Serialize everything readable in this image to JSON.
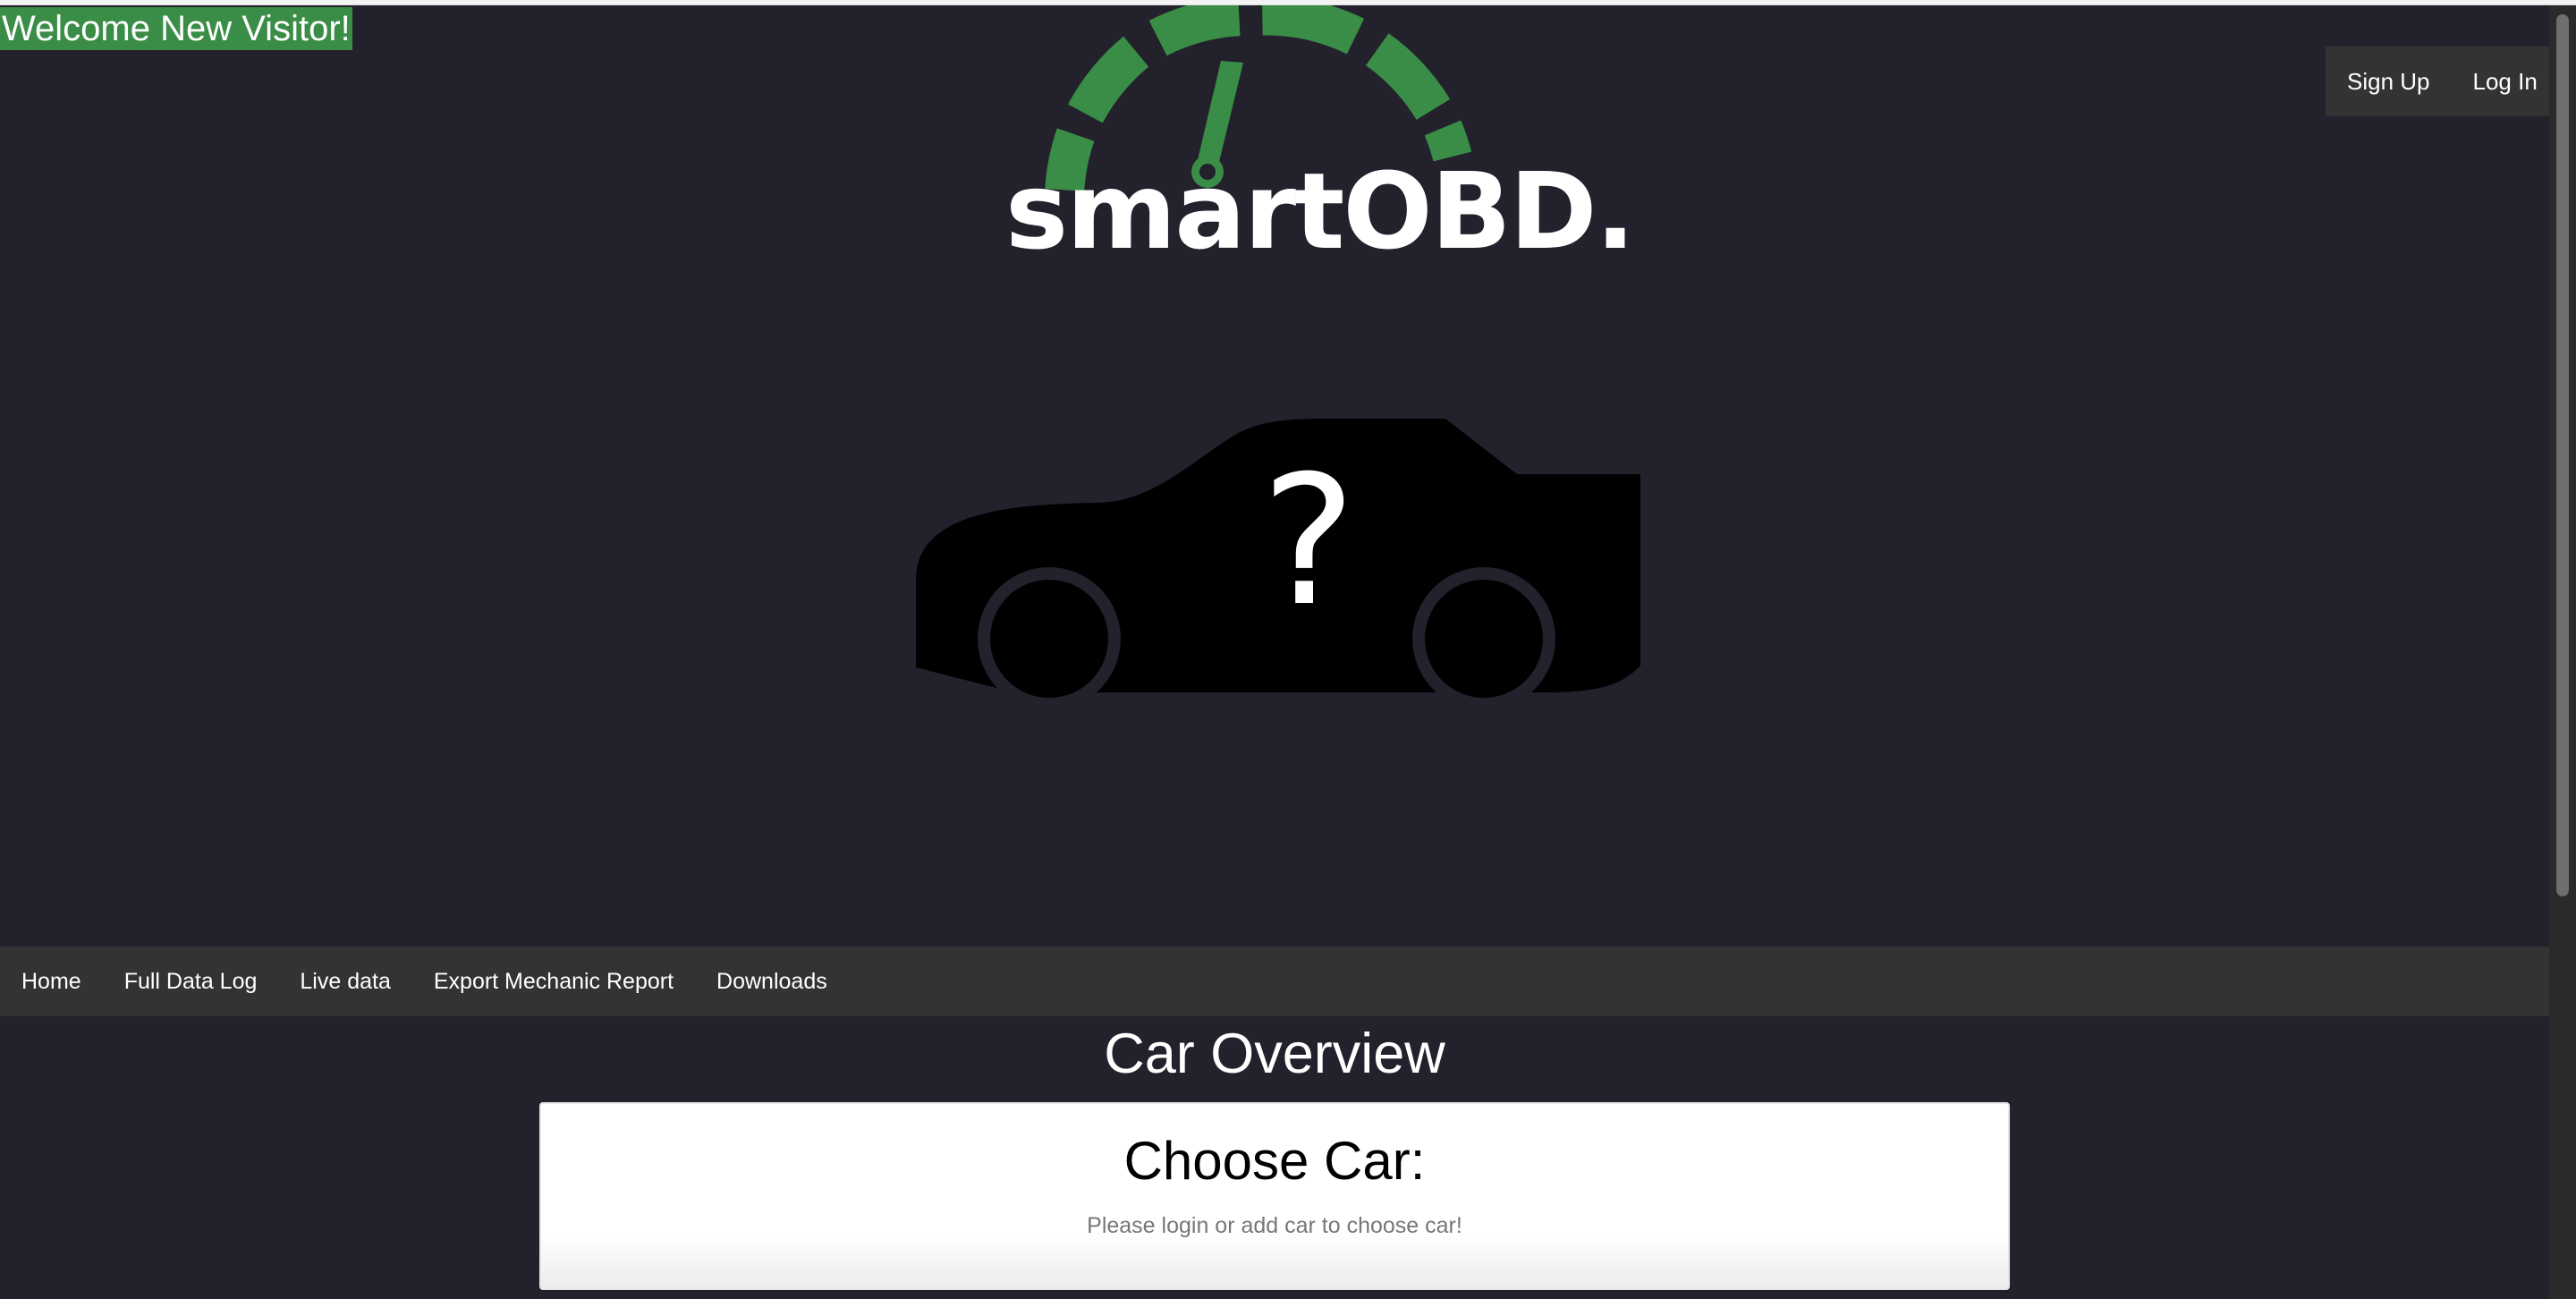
{
  "welcome": "Welcome New Visitor!",
  "auth": {
    "signup": "Sign Up",
    "login": "Log In"
  },
  "logo": {
    "text": "smartOBD.",
    "accent_color": "#3a8d46",
    "icon": "speedometer-icon"
  },
  "hero": {
    "icon": "car-unknown-icon",
    "glyph": "?"
  },
  "nav": {
    "items": [
      "Home",
      "Full Data Log",
      "Live data",
      "Export Mechanic Report",
      "Downloads"
    ]
  },
  "main": {
    "title": "Car Overview",
    "card": {
      "title": "Choose Car:",
      "subtitle": "Please login or add car to choose car!"
    }
  },
  "colors": {
    "background": "#22212c",
    "bar": "#333333",
    "welcome_bg": "#3a8d46"
  }
}
